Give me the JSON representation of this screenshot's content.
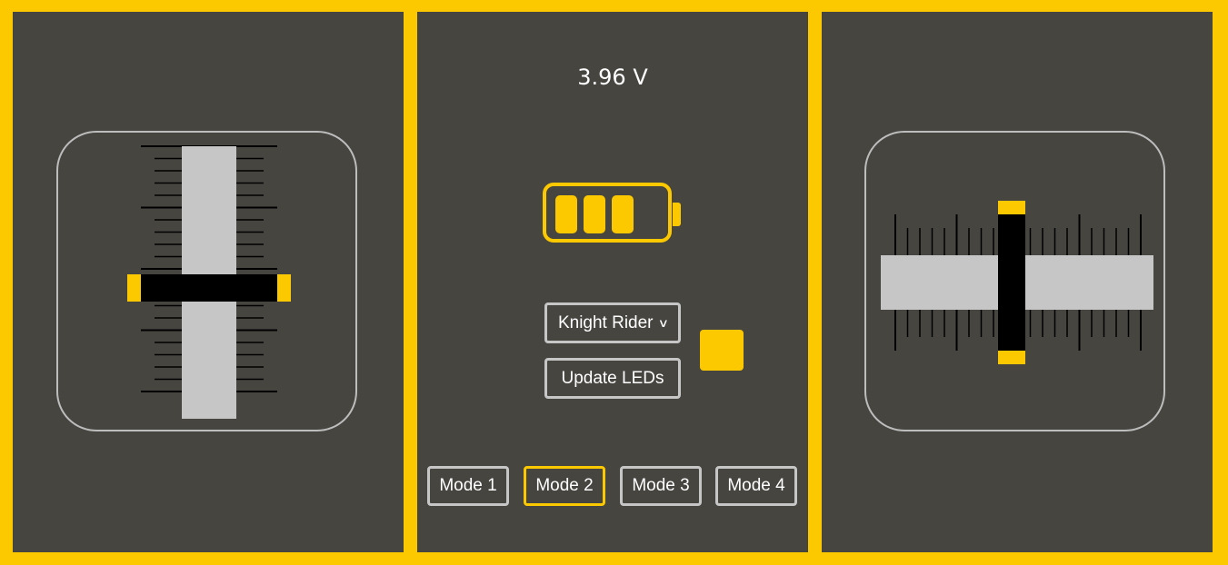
{
  "left_fader": {
    "level": 0.48,
    "orientation": "vertical"
  },
  "right_fader": {
    "level": 0.48,
    "orientation": "horizontal"
  },
  "status": {
    "voltage": "3.96 V",
    "battery_cells_filled": 3,
    "battery_cells_total": 3
  },
  "led": {
    "pattern_selected": "Knight Rider",
    "update_label": "Update LEDs",
    "color": "#fcc800"
  },
  "modes": [
    {
      "label": "Mode 1",
      "active": false
    },
    {
      "label": "Mode 2",
      "active": true
    },
    {
      "label": "Mode 3",
      "active": false
    },
    {
      "label": "Mode 4",
      "active": false
    }
  ],
  "colors": {
    "accent": "#fcc800",
    "panel": "#474540",
    "track": "#c6c6c6",
    "border": "#bdbdbd"
  }
}
